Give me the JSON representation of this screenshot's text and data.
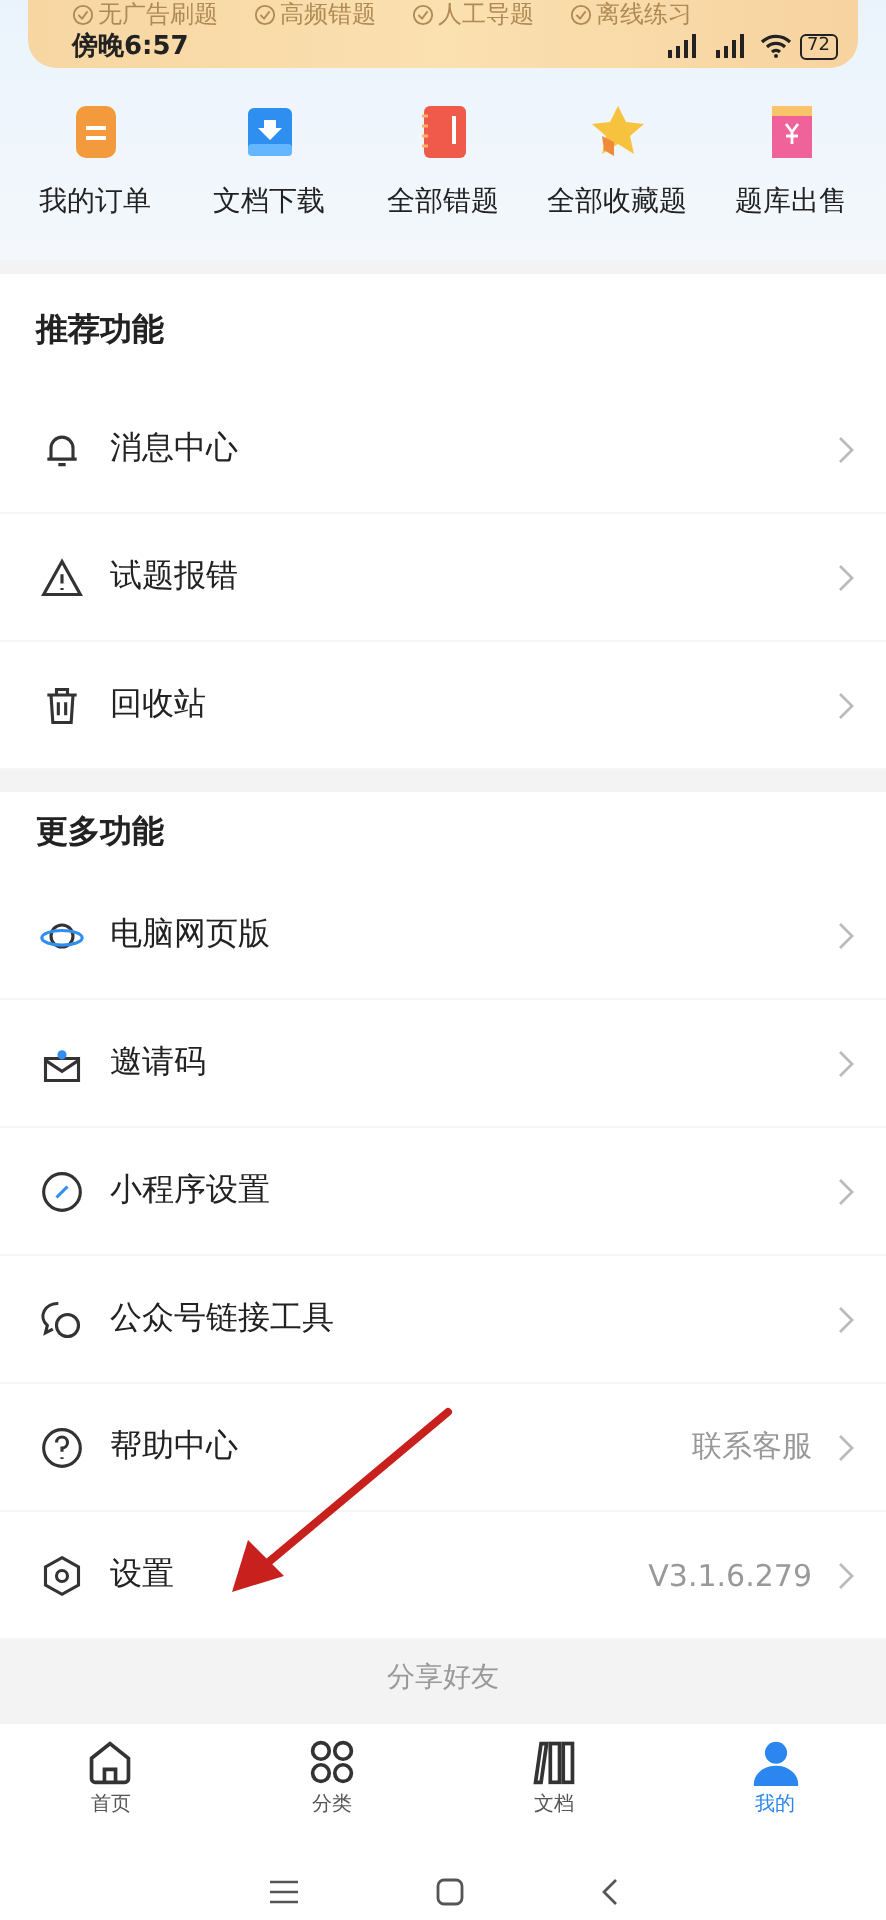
{
  "banner": {
    "features": [
      "无广告刷题",
      "高频错题",
      "人工导题",
      "离线练习"
    ]
  },
  "status_bar": {
    "time": "傍晚6:57",
    "battery": "72"
  },
  "shortcuts": [
    {
      "label": "我的订单",
      "kind": "order"
    },
    {
      "label": "文档下载",
      "kind": "download"
    },
    {
      "label": "全部错题",
      "kind": "notebook"
    },
    {
      "label": "全部收藏题",
      "kind": "star"
    },
    {
      "label": "题库出售",
      "kind": "sale"
    }
  ],
  "sections": [
    {
      "title": "推荐功能",
      "items": [
        {
          "label": "消息中心",
          "kind": "bell"
        },
        {
          "label": "试题报错",
          "kind": "warning"
        },
        {
          "label": "回收站",
          "kind": "trash"
        }
      ]
    },
    {
      "title": "更多功能",
      "items": [
        {
          "label": "电脑网页版",
          "kind": "planet"
        },
        {
          "label": "邀请码",
          "kind": "envelope"
        },
        {
          "label": "小程序设置",
          "kind": "link"
        },
        {
          "label": "公众号链接工具",
          "kind": "chat"
        },
        {
          "label": "帮助中心",
          "kind": "help",
          "value": "联系客服"
        },
        {
          "label": "设置",
          "kind": "settings",
          "value": "V3.1.6.279"
        }
      ]
    }
  ],
  "share": "分享好友",
  "tab_bar": [
    {
      "label": "首页",
      "kind": "home",
      "selected": false
    },
    {
      "label": "分类",
      "kind": "grid",
      "selected": false
    },
    {
      "label": "文档",
      "kind": "books",
      "selected": false
    },
    {
      "label": "我的",
      "kind": "person",
      "selected": true
    }
  ]
}
